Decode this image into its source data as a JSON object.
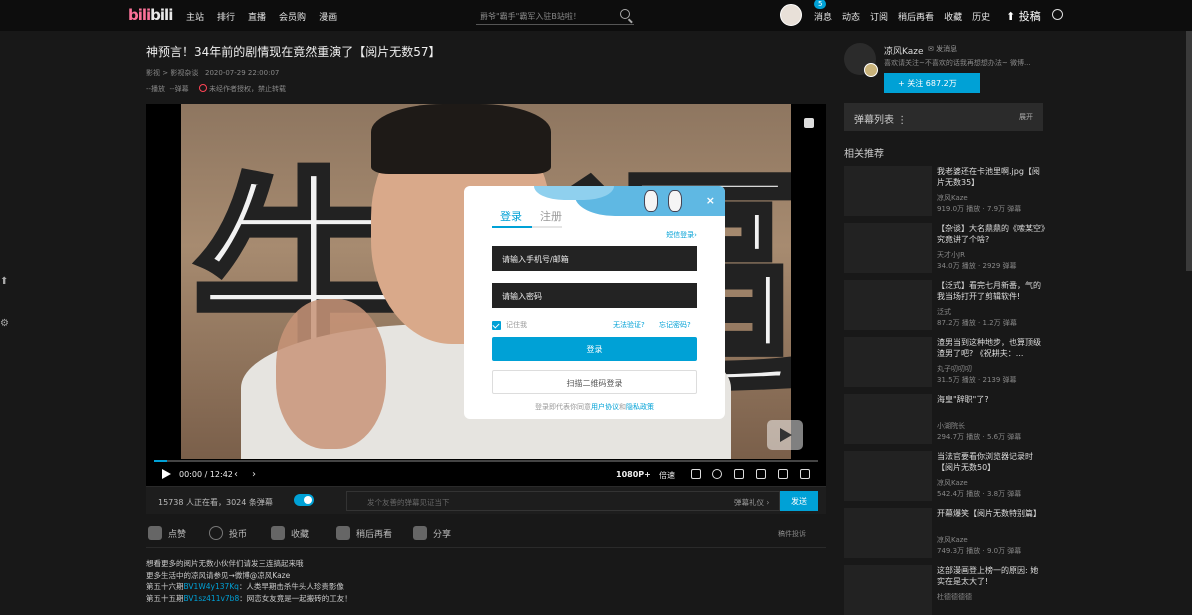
{
  "header": {
    "logo": "bilibili",
    "nav": [
      "主站",
      "排行",
      "直播",
      "会员购",
      "漫画"
    ],
    "search_placeholder": "爵爷\"霸手\"霸军入驻B站啦！",
    "badge": "5",
    "right_nav": [
      "消息",
      "动态",
      "订阅",
      "稍后再看",
      "收藏",
      "历史"
    ],
    "upload": "投稿"
  },
  "video": {
    "title": "神预言！34年前的剧情现在竟然重演了【阅片无数57】",
    "category": "影视 > 影视杂谈",
    "date": "2020-07-29 22:00:07",
    "plays": "--播放",
    "danmaku_count": "--弹幕",
    "copyright": "未经作者授权，禁止转载",
    "time": "00:00 / 12:42",
    "quality": "1080P+",
    "speed": "倍速",
    "progress": 0.02,
    "watching": "15738 人正在看，3024 条弹幕",
    "dm_placeholder": "发个友善的弹幕见证当下",
    "dm_etiquette": "弹幕礼仪 ›",
    "send": "发送"
  },
  "actions": [
    {
      "label": "点赞",
      "icon": "like-icon"
    },
    {
      "label": "投币",
      "icon": "coin-icon"
    },
    {
      "label": "收藏",
      "icon": "star-icon"
    },
    {
      "label": "稍后再看",
      "icon": "later-icon"
    },
    {
      "label": "分享",
      "icon": "share-icon"
    }
  ],
  "report": "稿件投诉",
  "description": {
    "l1": "想看更多的阅片无数小伙伴们请发三连搞起来哦",
    "l2": "更多生活中的凉风请参见→微博@凉风Kaze",
    "l3a": "第五十六期",
    "l3b": "BV1W4y137Kq",
    "l3c": "：人类早期击杀牛头人珍贵影像",
    "l4a": "第五十五期",
    "l4b": "BV1sz411v7b8",
    "l4c": "：网恋女友竟是一起搬砖的工友！"
  },
  "uploader": {
    "name": "凉风Kaze",
    "msg": "发消息",
    "sig": "喜欢请关注~不喜欢的话我再想想办法~ 微博...",
    "follow": "+  关注 687.2万"
  },
  "danmaku_list": {
    "title": "弹幕列表",
    "expand": "展开"
  },
  "related": {
    "heading": "相关推荐",
    "items": [
      {
        "title": "我老婆还在卡池里啊.jpg【阅片无数35】",
        "author": "凉风Kaze",
        "stats": "919.0万 播放 · 7.9万 弹幕"
      },
      {
        "title": "【杂谈】大名鼎鼎的《嗦某空》究竟讲了个啥?",
        "author": "天才小JR",
        "stats": "34.0万 播放 · 2929 弹幕"
      },
      {
        "title": "【泛式】看完七月新番，气的我当场打开了剪辑软件!",
        "author": "泛式",
        "stats": "87.2万 播放 · 1.2万 弹幕"
      },
      {
        "title": "渣男当到这种地步，也算顶级渣男了吧? 《祝耕夫：...",
        "author": "丸子叨叨叨",
        "stats": "31.5万 播放 · 2139 弹幕"
      },
      {
        "title": "海皇\"辞职\"了?",
        "author": "小湖院长",
        "stats": "294.7万 播放 · 5.6万 弹幕"
      },
      {
        "title": "当法官要看你浏览器记录时【阅片无数50】",
        "author": "凉风Kaze",
        "stats": "542.4万 播放 · 3.8万 弹幕"
      },
      {
        "title": "开幕爆笑【阅片无数特别篇】",
        "author": "凉风Kaze",
        "stats": "749.3万 播放 · 9.0万 弹幕"
      },
      {
        "title": "这部漫画登上榜一的原因: 她实在是太大了!",
        "author": "杜德德德德",
        "stats": ""
      }
    ]
  },
  "login": {
    "tab_login": "登录",
    "tab_register": "注册",
    "sms": "短信登录›",
    "user_placeholder": "请输入手机号/邮箱",
    "pass_placeholder": "请输入密码",
    "remember": "记住我",
    "cant_verify": "无法验证?",
    "forgot": "忘记密码?",
    "login_btn": "登录",
    "qr_btn": "扫描二维码登录",
    "agree_pre": "登录即代表你同意",
    "agree_link1": "用户协议",
    "agree_and": "和",
    "agree_link2": "隐私政策",
    "close": "×"
  },
  "colors": {
    "accent": "#00a1d6",
    "pink": "#fb7299"
  }
}
